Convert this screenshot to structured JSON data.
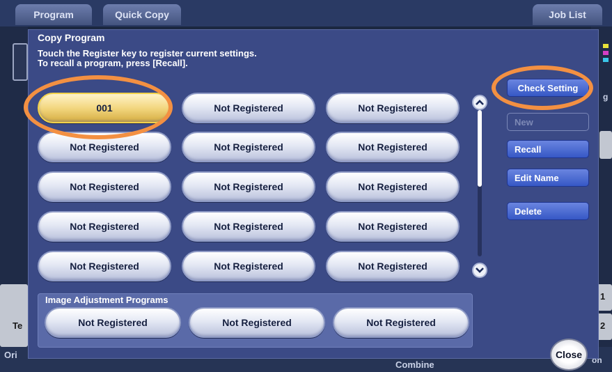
{
  "background": {
    "tab_program": "Program",
    "tab_quick_copy": "Quick Copy",
    "tab_job_list": "Job List",
    "left_label_te": "Te",
    "left_label_ori": "Ori",
    "bottom_combine": "Combine",
    "right_number_1": "1",
    "right_number_2": "2",
    "right_label_on": "on",
    "right_label_g": "g",
    "stripe_colors": [
      "#e8e23a",
      "#d43ec4",
      "#3ac6e8"
    ]
  },
  "dialog": {
    "title": "Copy Program",
    "message_line1": "Touch the Register key to register current settings.",
    "message_line2": "To recall a program, press [Recall].",
    "programs": [
      "001",
      "Not Registered",
      "Not Registered",
      "Not Registered",
      "Not Registered",
      "Not Registered",
      "Not Registered",
      "Not Registered",
      "Not Registered",
      "Not Registered",
      "Not Registered",
      "Not Registered",
      "Not Registered",
      "Not Registered",
      "Not Registered"
    ],
    "image_adjustment_label": "Image Adjustment Programs",
    "image_programs": [
      "Not Registered",
      "Not Registered",
      "Not Registered"
    ],
    "buttons": {
      "check_setting": "Check Setting",
      "new": "New",
      "recall": "Recall",
      "edit_name": "Edit Name",
      "delete": "Delete"
    },
    "close": "Close",
    "scroll_position": 0.0
  },
  "colors": {
    "dialog_bg": "#3b4a86",
    "selected_program": "#f3d780",
    "annotation_highlight": "#f39042",
    "action_button": "#3658c5"
  },
  "icons": {
    "scroll_up": "chevron-up-icon",
    "scroll_down": "chevron-down-icon"
  }
}
